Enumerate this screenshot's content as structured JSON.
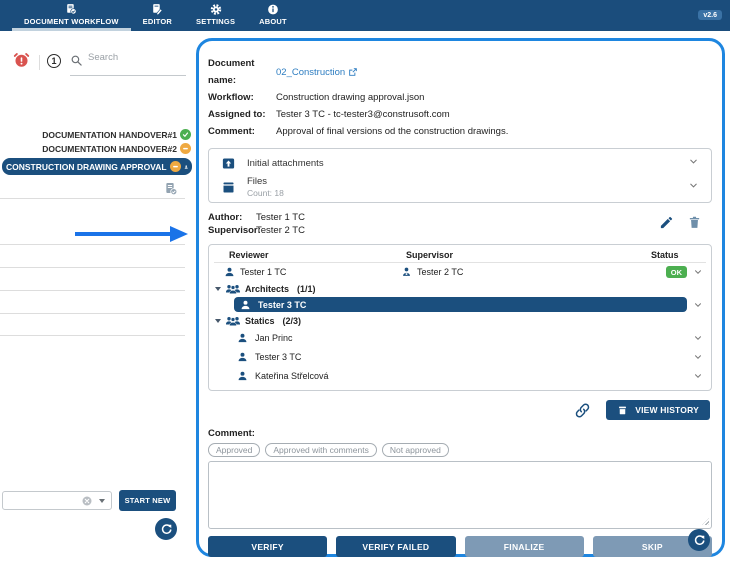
{
  "nav": {
    "tabs": [
      {
        "label": "DOCUMENT WORKFLOW",
        "icon": "document-check-icon",
        "active": true
      },
      {
        "label": "EDITOR",
        "icon": "document-edit-icon",
        "active": false
      },
      {
        "label": "SETTINGS",
        "icon": "gear-icon",
        "active": false
      },
      {
        "label": "ABOUT",
        "icon": "info-icon",
        "active": false
      }
    ],
    "version": "v2.6"
  },
  "sidebar": {
    "notification_count": "1",
    "search_placeholder": "Search",
    "items": [
      {
        "label": "DOCUMENTATION HANDOVER#1",
        "status": "done"
      },
      {
        "label": "DOCUMENTATION HANDOVER#2",
        "status": "pending"
      },
      {
        "label": "CONSTRUCTION DRAWING APPROVAL",
        "status": "pending",
        "selected": true
      }
    ],
    "start_new_label": "START NEW"
  },
  "main": {
    "details": [
      {
        "label": "Document name:",
        "value": "02_Construction",
        "link": true
      },
      {
        "label": "Workflow:",
        "value": "Construction drawing approval.json"
      },
      {
        "label": "Assigned to:",
        "value": "Tester 3 TC - tc-tester3@construsoft.com"
      },
      {
        "label": "Comment:",
        "value": "Approval of final versions od the construction drawings."
      }
    ],
    "attachments": [
      {
        "label": "Initial attachments"
      },
      {
        "label": "Files",
        "sub": "Count: 18"
      }
    ],
    "author_label": "Author:",
    "author": "Tester 1 TC",
    "supervisor_label": "Supervisor:",
    "supervisor": "Tester 2 TC",
    "table": {
      "headers": [
        "Reviewer",
        "Supervisor",
        "Status"
      ],
      "row1": {
        "reviewer": "Tester 1 TC",
        "supervisor": "Tester 2 TC",
        "status": "OK"
      },
      "groups": [
        {
          "name": "Architects",
          "count": "(1/1)",
          "members": [
            {
              "name": "Tester 3 TC",
              "selected": true
            }
          ]
        },
        {
          "name": "Statics",
          "count": "(2/3)",
          "members": [
            {
              "name": "Jan Princ"
            },
            {
              "name": "Tester 3 TC"
            },
            {
              "name": "Kateřina Střelcová"
            }
          ]
        }
      ]
    },
    "view_history_label": "VIEW HISTORY",
    "comment_label": "Comment:",
    "chips": [
      "Approved",
      "Approved with comments",
      "Not approved"
    ],
    "actions": [
      {
        "label": "VERIFY",
        "enabled": true
      },
      {
        "label": "VERIFY FAILED",
        "enabled": true
      },
      {
        "label": "FINALIZE",
        "enabled": false
      },
      {
        "label": "SKIP",
        "enabled": false
      }
    ]
  },
  "colors": {
    "navy": "#1b4f7e",
    "nav_bg": "#1b4d7c",
    "panel_border": "#1e86e0",
    "ok_green": "#4caf50",
    "pending_amber": "#efa941",
    "alert_red": "#d9534f",
    "link_blue": "#2d7dc1",
    "disabled_blue": "#7e9ab5",
    "arrow_blue": "#1a73e8"
  }
}
